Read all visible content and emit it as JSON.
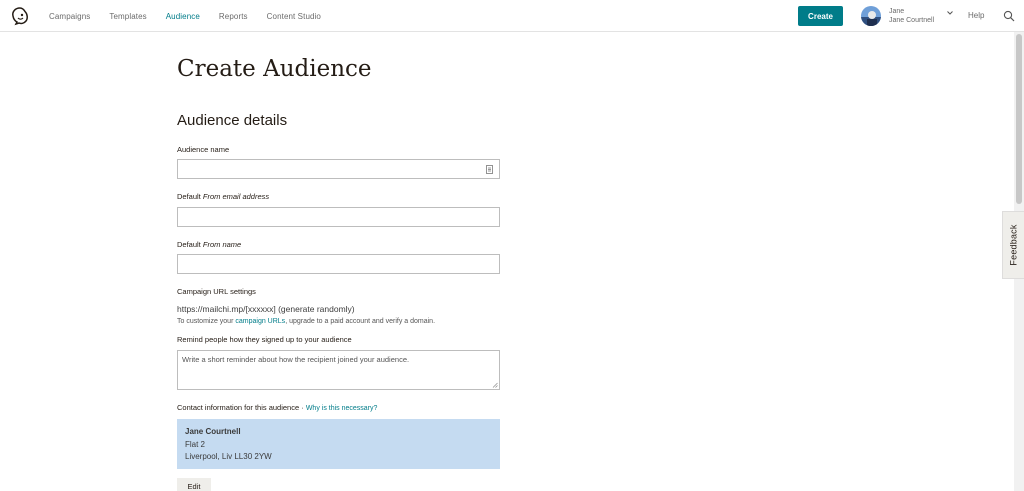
{
  "nav": {
    "items": [
      {
        "label": "Campaigns",
        "active": false
      },
      {
        "label": "Templates",
        "active": false
      },
      {
        "label": "Audience",
        "active": true
      },
      {
        "label": "Reports",
        "active": false
      },
      {
        "label": "Content Studio",
        "active": false
      }
    ],
    "create_label": "Create",
    "user_first": "Jane",
    "user_full": "Jane Courtnell",
    "help_label": "Help"
  },
  "colors": {
    "accent": "#007c89",
    "contact_box": "#c5dbf1"
  },
  "feedback_label": "Feedback",
  "page": {
    "title": "Create Audience",
    "section_title": "Audience details"
  },
  "form": {
    "audience_name_label": "Audience name",
    "audience_name_value": "",
    "from_email_label_prefix": "Default",
    "from_email_label_em": "From email address",
    "from_email_value": "",
    "from_name_label_prefix": "Default",
    "from_name_label_em": "From name",
    "from_name_value": "",
    "campaign_url_label": "Campaign URL settings",
    "campaign_url_value": "https://mailchi.mp/[xxxxxx] (generate randomly)",
    "campaign_url_help_pre": "To customize your",
    "campaign_url_help_link": "campaign URLs",
    "campaign_url_help_post": ", upgrade to a paid account and verify a domain.",
    "reminder_label": "Remind people how they signed up to your audience",
    "reminder_placeholder": "Write a short reminder about how the recipient joined your audience.",
    "contact_label": "Contact information for this audience ·",
    "contact_link": "Why is this necessary?",
    "contact": {
      "name": "Jane Courtnell",
      "line1": "Flat 2",
      "line2": "Liverpool, Liv LL30 2YW"
    },
    "edit_label": "Edit"
  }
}
